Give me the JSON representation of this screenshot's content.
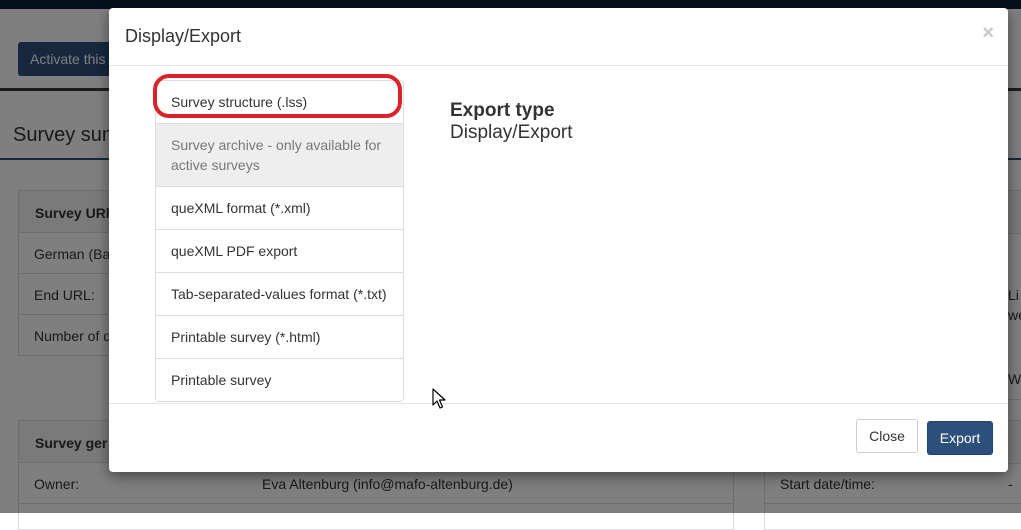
{
  "background": {
    "activate_button": "Activate this",
    "summary_title": "Survey sum",
    "urls_panel": {
      "header": "Survey URl",
      "rows": [
        "German (Ba",
        "End URL:",
        "Number of q"
      ]
    },
    "right_fragments": [
      "Li",
      "we",
      "W"
    ],
    "general_panel": {
      "header": "Survey ger",
      "owner_label": "Owner:",
      "owner_value": "Eva Altenburg (info@mafo-altenburg.de)",
      "start_label": "Start date/time:",
      "start_value": "-"
    }
  },
  "modal": {
    "title": "Display/Export",
    "close_icon": "×",
    "export_options": [
      {
        "label": "Survey structure (.lss)",
        "disabled": false
      },
      {
        "label": "Survey archive - only available for active surveys",
        "disabled": true
      },
      {
        "label": "queXML format (*.xml)",
        "disabled": false
      },
      {
        "label": "queXML PDF export",
        "disabled": false
      },
      {
        "label": "Tab-separated-values format (*.txt)",
        "disabled": false
      },
      {
        "label": "Printable survey (*.html)",
        "disabled": false
      },
      {
        "label": "Printable survey",
        "disabled": false
      }
    ],
    "export_type_label": "Export type",
    "export_type_value": "Display/Export",
    "close_button": "Close",
    "export_button": "Export"
  },
  "colors": {
    "primary": "#2c4f7c",
    "highlight": "#d9232b"
  }
}
